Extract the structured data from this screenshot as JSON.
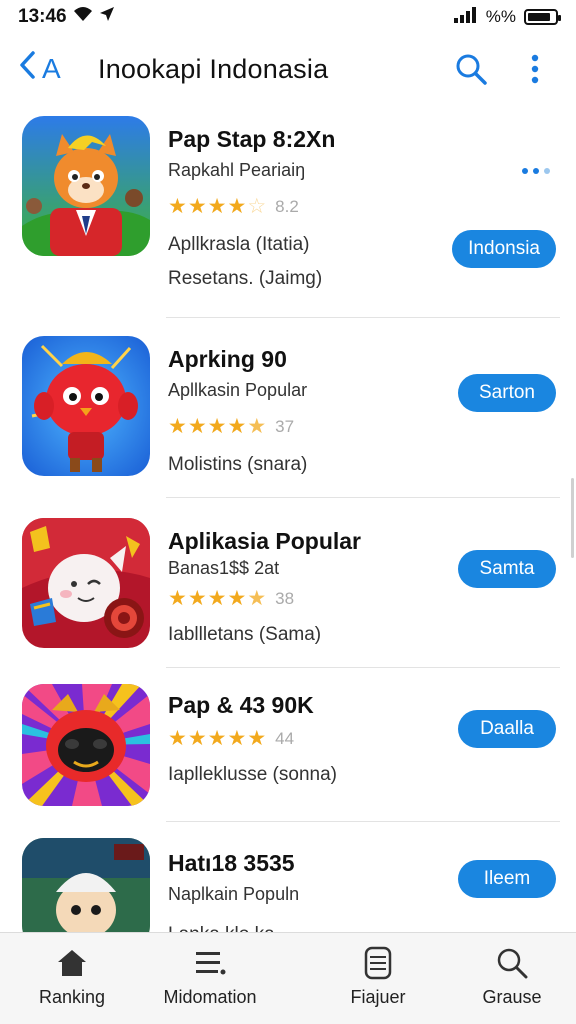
{
  "status_bar": {
    "time": "13:46",
    "battery_text": "%%",
    "battery_level": 0.85
  },
  "header": {
    "back_label": "A",
    "title": "Inookapi Indonasia"
  },
  "apps": [
    {
      "name": "Pap Stap 8:2Xn",
      "subtitle": "Rapkahl Peariaiŋ",
      "stars": 4,
      "rating_label": "8.2",
      "extra": "Apllkrasla (Itatia)",
      "extra2": "Resetans. (Jaimg)",
      "button": "Indonsia",
      "icon": "fox-character-icon"
    },
    {
      "name": "Aprking 90",
      "subtitle": "Apllkasin Popular",
      "stars": 4.5,
      "rating_label": "37",
      "extra": "Molistins (snara)",
      "button": "Sarton",
      "icon": "red-bird-character-icon"
    },
    {
      "name": "Aplikasia Popular",
      "subtitle": "Banas1$$ 2at",
      "stars": 4.5,
      "rating_label": "38",
      "extra": "Iabllletans (Sama)",
      "button": "Samta",
      "icon": "white-cat-character-icon"
    },
    {
      "name": "Pap & 43 90K",
      "subtitle": "",
      "stars": 5,
      "rating_label": "44",
      "extra": "Iaplleklusse (sonna)",
      "button": "Daalla",
      "icon": "dark-monster-character-icon"
    },
    {
      "name": "Hatı18 3535",
      "subtitle": "Naplkain Populn",
      "stars": 0,
      "rating_label": "",
      "extra": "Lanka klo ka",
      "button": "Ileem",
      "icon": "viking-character-icon"
    }
  ],
  "tabs": [
    {
      "label": "Ranking",
      "icon": "home-icon"
    },
    {
      "label": "Midomation",
      "icon": "list-icon"
    },
    {
      "label": "Fiajuer",
      "icon": "jar-icon"
    },
    {
      "label": "Grause",
      "icon": "search-icon"
    }
  ],
  "colors": {
    "accent": "#1a86e0",
    "star": "#f2a91d",
    "tab_bar": "#f6f6f6"
  }
}
